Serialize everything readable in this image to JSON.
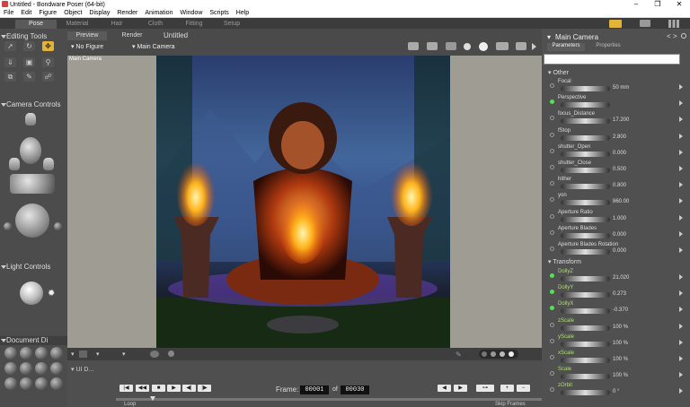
{
  "window": {
    "title": "Untitled - Bondware Poser (64-bit)",
    "controls": [
      "–",
      "❐",
      "✕"
    ]
  },
  "menu": [
    "File",
    "Edit",
    "Figure",
    "Object",
    "Display",
    "Render",
    "Animation",
    "Window",
    "Scripts",
    "Help"
  ],
  "rooms": [
    "Pose",
    "Material",
    "Hair",
    "Cloth",
    "Fitting",
    "Setup"
  ],
  "active_room": "Pose",
  "document": {
    "tabs": [
      "Preview",
      "Render"
    ],
    "title": "Untitled",
    "active_tab": "Render"
  },
  "left": {
    "editing_tools": "Editing Tools",
    "camera_controls": "Camera Controls",
    "light_controls": "Light Controls",
    "document_display": "Document Di",
    "ui_dots": "UI D..."
  },
  "viewport": {
    "figure_select": "No Figure",
    "camera_select": "Main Camera",
    "label": "Main Camera"
  },
  "anim": {
    "frame_label": "Frame:",
    "frame_current": "00001",
    "of_label": "of",
    "frame_total": "00030",
    "loop": "Loop",
    "skip": "Skip Frames"
  },
  "right": {
    "title": "Main Camera",
    "tabs": [
      "Parameters",
      "Properties"
    ],
    "search_placeholder": "",
    "section_other": "Other",
    "section_transform": "Transform",
    "other": [
      {
        "name": "Focal",
        "value": "50 mm",
        "on": false,
        "green": false
      },
      {
        "name": "Perspective",
        "value": "",
        "on": true,
        "green": false
      },
      {
        "name": "focus_Distance",
        "value": "17.200",
        "on": false,
        "green": false
      },
      {
        "name": "fStop",
        "value": "2.800",
        "on": false,
        "green": false
      },
      {
        "name": "shutter_Open",
        "value": "0.000",
        "on": false,
        "green": false
      },
      {
        "name": "shutter_Close",
        "value": "0.500",
        "on": false,
        "green": false
      },
      {
        "name": "hither",
        "value": "0.800",
        "on": false,
        "green": false
      },
      {
        "name": "yon",
        "value": "860.00",
        "on": false,
        "green": false
      },
      {
        "name": "Aperture Ratio",
        "value": "1.000",
        "on": false,
        "green": false
      },
      {
        "name": "Aperture Blades",
        "value": "0.000",
        "on": false,
        "green": false
      },
      {
        "name": "Aperture Blades Rotation",
        "value": "0.000",
        "on": false,
        "green": false
      }
    ],
    "transform": [
      {
        "name": "DollyZ",
        "value": "21.020",
        "on": true,
        "green": true
      },
      {
        "name": "DollyY",
        "value": "0.273",
        "on": true,
        "green": true
      },
      {
        "name": "DollyX",
        "value": "-0.370",
        "on": true,
        "green": true
      },
      {
        "name": "zScale",
        "value": "100 %",
        "on": false,
        "green": true
      },
      {
        "name": "yScale",
        "value": "100 %",
        "on": false,
        "green": true
      },
      {
        "name": "xScale",
        "value": "100 %",
        "on": false,
        "green": true
      },
      {
        "name": "Scale",
        "value": "100 %",
        "on": false,
        "green": true
      },
      {
        "name": "zOrbit",
        "value": "0 °",
        "on": false,
        "green": true
      }
    ]
  }
}
